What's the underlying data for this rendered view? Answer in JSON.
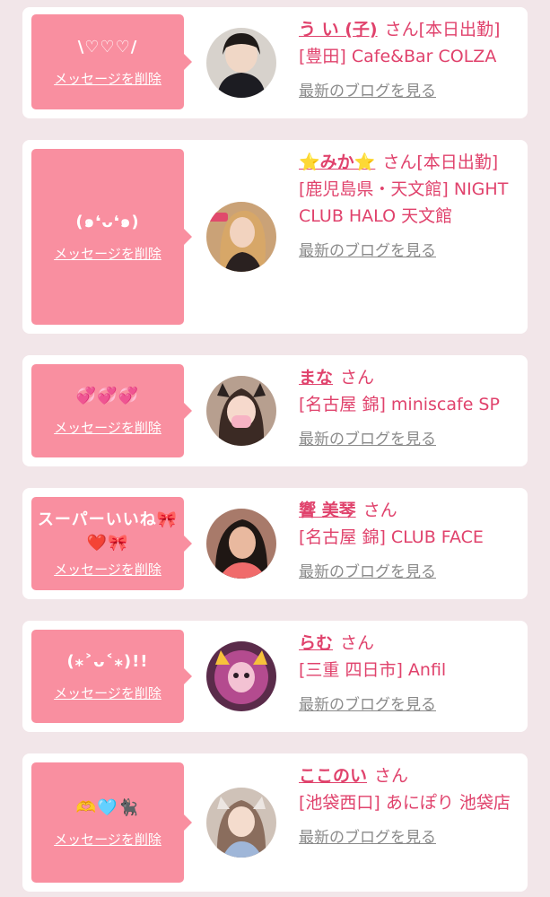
{
  "cards": [
    {
      "message": "\\♡♡♡/",
      "delete_label": "メッセージを削除",
      "name": "う い (子)",
      "suffix": "さん",
      "shop": "[本日出勤][豊田] Cafe&Bar COLZA",
      "blog_label": "最新のブログを見る",
      "avatar_bg": "#d7d2cc"
    },
    {
      "message": "(๑❛ᴗ❛๑)",
      "delete_label": "メッセージを削除",
      "name": "⭐みか⭐",
      "suffix": "さん",
      "shop": "[本日出勤][鹿児島県・天文館] NIGHT CLUB HALO 天文館",
      "blog_label": "最新のブログを見る",
      "avatar_bg": "#caa277"
    },
    {
      "message": "💞💞💞",
      "delete_label": "メッセージを削除",
      "name": "まな",
      "suffix": "さん",
      "shop": "[名古屋 錦] miniscafe SP",
      "blog_label": "最新のブログを見る",
      "avatar_bg": "#b79f8f"
    },
    {
      "message": "スーパーいいね🎀❤️🎀",
      "delete_label": "メッセージを削除",
      "name": "響 美琴",
      "suffix": "さん",
      "shop": "[名古屋 錦] CLUB FACE",
      "blog_label": "最新のブログを見る",
      "avatar_bg": "#a87a6a"
    },
    {
      "message": "(⁎˃ᴗ˂⁎)!!",
      "delete_label": "メッセージを削除",
      "name": "らむ",
      "suffix": "さん",
      "shop": "[三重 四日市] Anfil",
      "blog_label": "最新のブログを見る",
      "avatar_bg": "#b44b8f"
    },
    {
      "message": "🫶🩵🐈‍⬛",
      "delete_label": "メッセージを削除",
      "name": "ここのい",
      "suffix": "さん",
      "shop": "[池袋西口] あにぽり 池袋店",
      "blog_label": "最新のブログを見る",
      "avatar_bg": "#cfc2b8"
    }
  ],
  "colors": {
    "background": "#f2e6e9",
    "bubble": "#f98fa0",
    "accent_text": "#e0426c",
    "muted_link": "#8a8a8a"
  }
}
